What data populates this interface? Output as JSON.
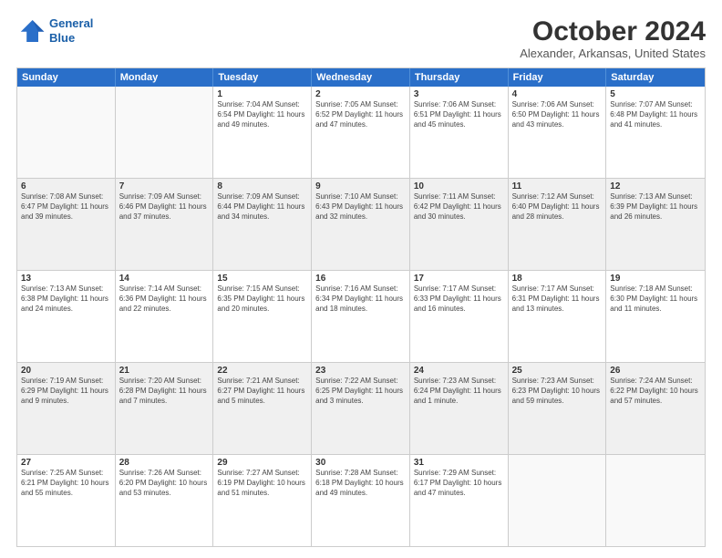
{
  "header": {
    "logo_line1": "General",
    "logo_line2": "Blue",
    "title": "October 2024",
    "subtitle": "Alexander, Arkansas, United States"
  },
  "days_of_week": [
    "Sunday",
    "Monday",
    "Tuesday",
    "Wednesday",
    "Thursday",
    "Friday",
    "Saturday"
  ],
  "weeks": [
    [
      {
        "day": "",
        "info": ""
      },
      {
        "day": "",
        "info": ""
      },
      {
        "day": "1",
        "info": "Sunrise: 7:04 AM\nSunset: 6:54 PM\nDaylight: 11 hours and 49 minutes."
      },
      {
        "day": "2",
        "info": "Sunrise: 7:05 AM\nSunset: 6:52 PM\nDaylight: 11 hours and 47 minutes."
      },
      {
        "day": "3",
        "info": "Sunrise: 7:06 AM\nSunset: 6:51 PM\nDaylight: 11 hours and 45 minutes."
      },
      {
        "day": "4",
        "info": "Sunrise: 7:06 AM\nSunset: 6:50 PM\nDaylight: 11 hours and 43 minutes."
      },
      {
        "day": "5",
        "info": "Sunrise: 7:07 AM\nSunset: 6:48 PM\nDaylight: 11 hours and 41 minutes."
      }
    ],
    [
      {
        "day": "6",
        "info": "Sunrise: 7:08 AM\nSunset: 6:47 PM\nDaylight: 11 hours and 39 minutes."
      },
      {
        "day": "7",
        "info": "Sunrise: 7:09 AM\nSunset: 6:46 PM\nDaylight: 11 hours and 37 minutes."
      },
      {
        "day": "8",
        "info": "Sunrise: 7:09 AM\nSunset: 6:44 PM\nDaylight: 11 hours and 34 minutes."
      },
      {
        "day": "9",
        "info": "Sunrise: 7:10 AM\nSunset: 6:43 PM\nDaylight: 11 hours and 32 minutes."
      },
      {
        "day": "10",
        "info": "Sunrise: 7:11 AM\nSunset: 6:42 PM\nDaylight: 11 hours and 30 minutes."
      },
      {
        "day": "11",
        "info": "Sunrise: 7:12 AM\nSunset: 6:40 PM\nDaylight: 11 hours and 28 minutes."
      },
      {
        "day": "12",
        "info": "Sunrise: 7:13 AM\nSunset: 6:39 PM\nDaylight: 11 hours and 26 minutes."
      }
    ],
    [
      {
        "day": "13",
        "info": "Sunrise: 7:13 AM\nSunset: 6:38 PM\nDaylight: 11 hours and 24 minutes."
      },
      {
        "day": "14",
        "info": "Sunrise: 7:14 AM\nSunset: 6:36 PM\nDaylight: 11 hours and 22 minutes."
      },
      {
        "day": "15",
        "info": "Sunrise: 7:15 AM\nSunset: 6:35 PM\nDaylight: 11 hours and 20 minutes."
      },
      {
        "day": "16",
        "info": "Sunrise: 7:16 AM\nSunset: 6:34 PM\nDaylight: 11 hours and 18 minutes."
      },
      {
        "day": "17",
        "info": "Sunrise: 7:17 AM\nSunset: 6:33 PM\nDaylight: 11 hours and 16 minutes."
      },
      {
        "day": "18",
        "info": "Sunrise: 7:17 AM\nSunset: 6:31 PM\nDaylight: 11 hours and 13 minutes."
      },
      {
        "day": "19",
        "info": "Sunrise: 7:18 AM\nSunset: 6:30 PM\nDaylight: 11 hours and 11 minutes."
      }
    ],
    [
      {
        "day": "20",
        "info": "Sunrise: 7:19 AM\nSunset: 6:29 PM\nDaylight: 11 hours and 9 minutes."
      },
      {
        "day": "21",
        "info": "Sunrise: 7:20 AM\nSunset: 6:28 PM\nDaylight: 11 hours and 7 minutes."
      },
      {
        "day": "22",
        "info": "Sunrise: 7:21 AM\nSunset: 6:27 PM\nDaylight: 11 hours and 5 minutes."
      },
      {
        "day": "23",
        "info": "Sunrise: 7:22 AM\nSunset: 6:25 PM\nDaylight: 11 hours and 3 minutes."
      },
      {
        "day": "24",
        "info": "Sunrise: 7:23 AM\nSunset: 6:24 PM\nDaylight: 11 hours and 1 minute."
      },
      {
        "day": "25",
        "info": "Sunrise: 7:23 AM\nSunset: 6:23 PM\nDaylight: 10 hours and 59 minutes."
      },
      {
        "day": "26",
        "info": "Sunrise: 7:24 AM\nSunset: 6:22 PM\nDaylight: 10 hours and 57 minutes."
      }
    ],
    [
      {
        "day": "27",
        "info": "Sunrise: 7:25 AM\nSunset: 6:21 PM\nDaylight: 10 hours and 55 minutes."
      },
      {
        "day": "28",
        "info": "Sunrise: 7:26 AM\nSunset: 6:20 PM\nDaylight: 10 hours and 53 minutes."
      },
      {
        "day": "29",
        "info": "Sunrise: 7:27 AM\nSunset: 6:19 PM\nDaylight: 10 hours and 51 minutes."
      },
      {
        "day": "30",
        "info": "Sunrise: 7:28 AM\nSunset: 6:18 PM\nDaylight: 10 hours and 49 minutes."
      },
      {
        "day": "31",
        "info": "Sunrise: 7:29 AM\nSunset: 6:17 PM\nDaylight: 10 hours and 47 minutes."
      },
      {
        "day": "",
        "info": ""
      },
      {
        "day": "",
        "info": ""
      }
    ]
  ]
}
